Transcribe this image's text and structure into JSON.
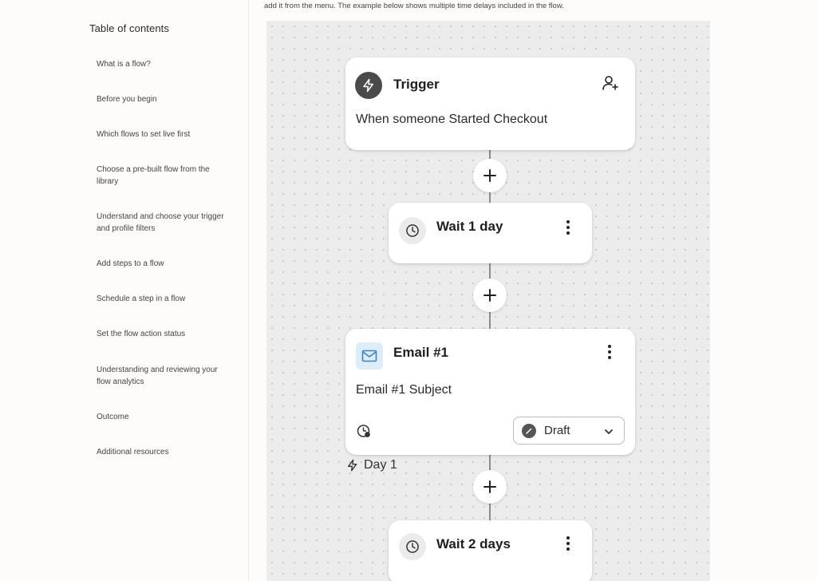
{
  "intro_text": "add it from the menu. The example below shows multiple time delays included in the flow.",
  "toc": {
    "title": "Table of contents",
    "items": [
      "What is a flow?",
      "Before you begin",
      "Which flows to set live first",
      "Choose a pre-built flow from the library",
      "Understand and choose your trigger and profile filters",
      "Add steps to a flow",
      "Schedule a step in a flow",
      "Set the flow action status",
      "Understanding and reviewing your flow analytics",
      "Outcome",
      "Additional resources"
    ]
  },
  "flow": {
    "trigger": {
      "title": "Trigger",
      "description": "When someone Started Checkout",
      "icon": "lightning-icon",
      "action_icon": "add-user-icon"
    },
    "wait1": {
      "label": "Wait 1 day",
      "icon": "clock-icon"
    },
    "email1": {
      "title": "Email #1",
      "subject": "Email #1 Subject",
      "status": "Draft",
      "icon": "mail-icon"
    },
    "day_marker": "Day 1",
    "wait2": {
      "label": "Wait 2 days",
      "icon": "clock-icon"
    }
  },
  "colors": {
    "canvas_bg": "#ececec",
    "trigger_icon_bg": "#4a4a4a",
    "email_icon_bg": "#dceefb",
    "email_icon_stroke": "#3b82c4"
  }
}
